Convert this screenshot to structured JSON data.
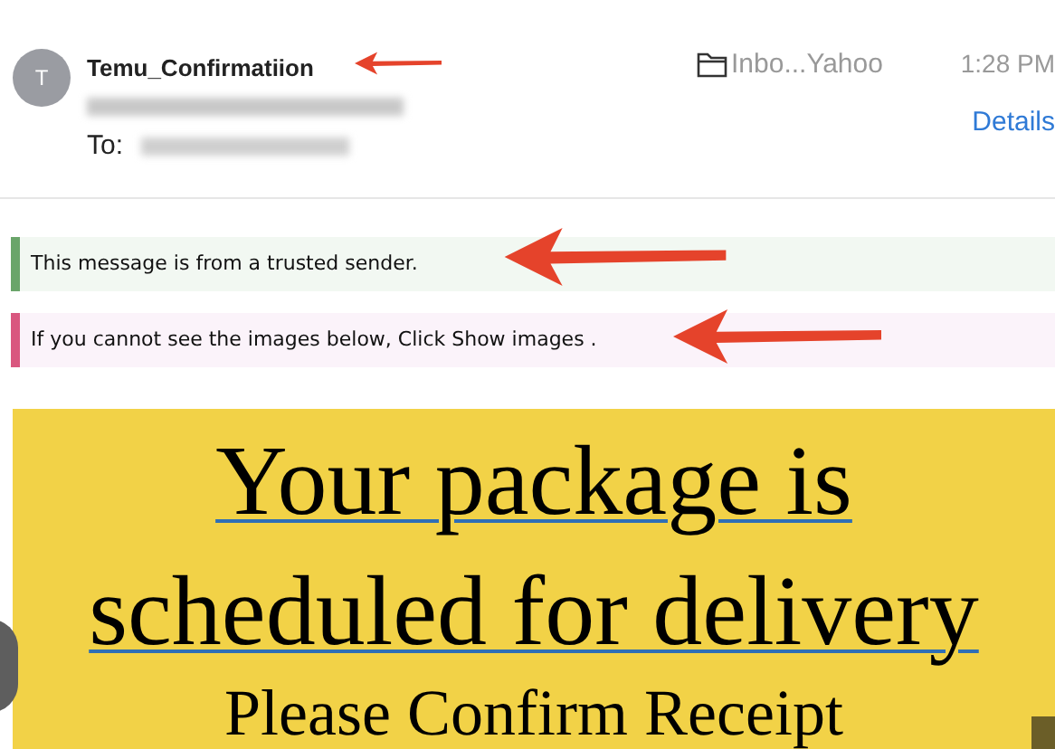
{
  "header": {
    "avatar_initial": "T",
    "sender": "Temu_Confirmatiion",
    "to_label": "To:",
    "folder": "Inbo...Yahoo",
    "time": "1:28 PM",
    "details_link": "Details"
  },
  "banners": [
    {
      "kind": "trusted",
      "text": "This message is from a trusted sender.",
      "color": "#6aa56a"
    },
    {
      "kind": "images",
      "text": "If you cannot see the images below, Click Show images .",
      "color": "#d9577f"
    }
  ],
  "body": {
    "headline": "Your package is scheduled for delivery",
    "subheading": "Please Confirm Receipt"
  }
}
